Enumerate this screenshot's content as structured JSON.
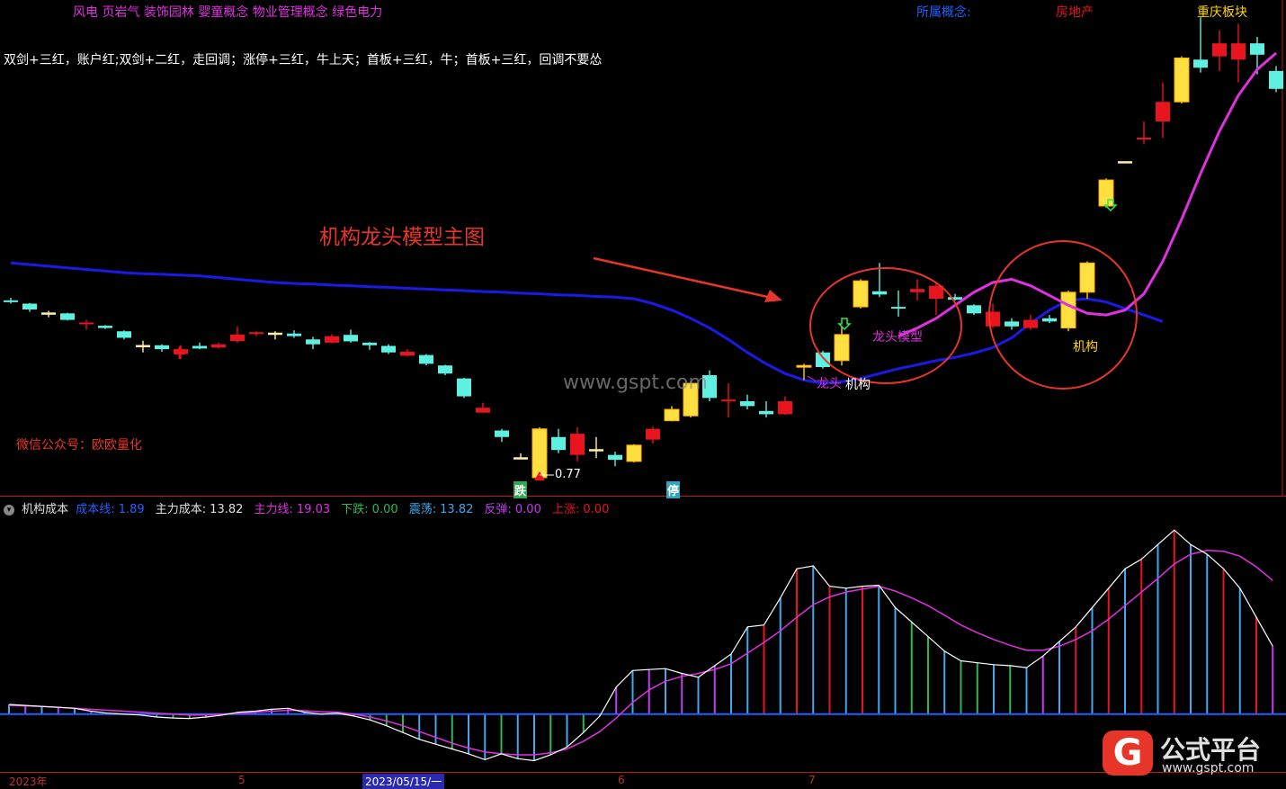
{
  "concepts": {
    "left": "风电 页岩气 装饰园林 婴童概念 物业管理概念 绿色电力",
    "belong_label": "所属概念:",
    "industry": "房地产",
    "region": "重庆板块"
  },
  "strategy_text": "双剑+三红，账户红;双剑+二红，走回调；涨停+三红，牛上天；首板+三红，牛；首板+三红，回调不要怂",
  "chart_title": "机构龙头模型主图",
  "wechat": "微信公众号：欧欧量化",
  "watermark": "www.gspt.com",
  "annotations": {
    "low_price": "0.77",
    "down_signal": "跌",
    "limit_signal": "停",
    "dragon_model": "龙头模型",
    "dragon": "龙头",
    "institution_1": "机构",
    "institution_2": "机构"
  },
  "indicator": {
    "name": "机构成本",
    "cost_line_label": "成本线:",
    "cost_line_value": "1.89",
    "main_cost_label": "主力成本:",
    "main_cost_value": "13.82",
    "main_line_label": "主力线:",
    "main_line_value": "19.03",
    "down_label": "下跌:",
    "down_value": "0.00",
    "shock_label": "震荡:",
    "shock_value": "13.82",
    "rebound_label": "反弹:",
    "rebound_value": "0.00",
    "up_label": "上涨:",
    "up_value": "0.00"
  },
  "dates": {
    "d1": "2023年",
    "d2": "5",
    "d3": "2023/05/15/一",
    "d4": "6",
    "d5": "7"
  },
  "logo": {
    "mark": "G",
    "name": "公式平台",
    "url": "www.gspt.com"
  },
  "colors": {
    "up_red": "#e8141e",
    "up_yellow": "#ffd400",
    "down_cyan": "#5ef0e0",
    "cost_line_blue": "#1a1ae6",
    "main_line_magenta": "#e030e0",
    "annotation_red": "#e8352a"
  },
  "chart_data": {
    "type": "candlestick",
    "candles": [
      {
        "o": 7.9,
        "c": 7.85,
        "h": 7.98,
        "l": 7.8,
        "t": "d"
      },
      {
        "o": 7.8,
        "c": 7.62,
        "h": 7.82,
        "l": 7.55,
        "t": "d"
      },
      {
        "o": 7.5,
        "c": 7.5,
        "h": 7.58,
        "l": 7.38,
        "t": "s"
      },
      {
        "o": 7.5,
        "c": 7.3,
        "h": 7.52,
        "l": 7.28,
        "t": "d"
      },
      {
        "o": 7.22,
        "c": 7.2,
        "h": 7.3,
        "l": 7.0,
        "t": "r"
      },
      {
        "o": 7.12,
        "c": 7.05,
        "h": 7.14,
        "l": 7.02,
        "t": "d"
      },
      {
        "o": 6.95,
        "c": 6.75,
        "h": 6.98,
        "l": 6.7,
        "t": "d"
      },
      {
        "o": 6.5,
        "c": 6.5,
        "h": 6.66,
        "l": 6.3,
        "t": "s"
      },
      {
        "o": 6.52,
        "c": 6.4,
        "h": 6.55,
        "l": 6.32,
        "t": "d"
      },
      {
        "o": 6.25,
        "c": 6.4,
        "h": 6.52,
        "l": 6.1,
        "t": "r"
      },
      {
        "o": 6.5,
        "c": 6.42,
        "h": 6.6,
        "l": 6.4,
        "t": "d"
      },
      {
        "o": 6.45,
        "c": 6.55,
        "h": 6.6,
        "l": 6.42,
        "t": "r"
      },
      {
        "o": 6.65,
        "c": 6.85,
        "h": 7.1,
        "l": 6.6,
        "t": "r"
      },
      {
        "o": 6.92,
        "c": 6.92,
        "h": 6.95,
        "l": 6.8,
        "t": "r"
      },
      {
        "o": 6.88,
        "c": 6.88,
        "h": 6.95,
        "l": 6.7,
        "t": "s"
      },
      {
        "o": 6.88,
        "c": 6.8,
        "h": 6.98,
        "l": 6.75,
        "t": "d"
      },
      {
        "o": 6.7,
        "c": 6.55,
        "h": 6.78,
        "l": 6.4,
        "t": "d"
      },
      {
        "o": 6.6,
        "c": 6.8,
        "h": 6.86,
        "l": 6.58,
        "t": "r"
      },
      {
        "o": 6.84,
        "c": 6.64,
        "h": 7.0,
        "l": 6.6,
        "t": "d"
      },
      {
        "o": 6.6,
        "c": 6.52,
        "h": 6.62,
        "l": 6.38,
        "t": "d"
      },
      {
        "o": 6.5,
        "c": 6.3,
        "h": 6.55,
        "l": 6.25,
        "t": "d"
      },
      {
        "o": 6.32,
        "c": 6.2,
        "h": 6.4,
        "l": 6.18,
        "t": "r"
      },
      {
        "o": 6.22,
        "c": 5.95,
        "h": 6.25,
        "l": 5.9,
        "t": "d"
      },
      {
        "o": 5.9,
        "c": 5.65,
        "h": 5.92,
        "l": 5.6,
        "t": "d"
      },
      {
        "o": 5.5,
        "c": 4.95,
        "h": 5.52,
        "l": 4.9,
        "t": "d"
      },
      {
        "o": 4.6,
        "c": 4.45,
        "h": 4.75,
        "l": 4.45,
        "t": "r"
      },
      {
        "o": 3.9,
        "c": 3.7,
        "h": 3.95,
        "l": 3.55,
        "t": "d"
      },
      {
        "o": 3.05,
        "c": 3.05,
        "h": 3.2,
        "l": 3.05,
        "t": "s"
      },
      {
        "o": 2.45,
        "c": 3.95,
        "h": 4.0,
        "l": 2.4,
        "t": "y"
      },
      {
        "o": 3.7,
        "c": 3.3,
        "h": 3.95,
        "l": 3.2,
        "t": "d"
      },
      {
        "o": 3.15,
        "c": 3.8,
        "h": 4.0,
        "l": 2.95,
        "t": "r"
      },
      {
        "o": 3.3,
        "c": 3.3,
        "h": 3.7,
        "l": 3.05,
        "t": "s"
      },
      {
        "o": 3.15,
        "c": 3.0,
        "h": 3.25,
        "l": 2.8,
        "t": "d"
      },
      {
        "o": 2.95,
        "c": 3.45,
        "h": 3.48,
        "l": 2.92,
        "t": "y"
      },
      {
        "o": 3.62,
        "c": 3.95,
        "h": 4.02,
        "l": 3.5,
        "t": "r"
      },
      {
        "o": 4.2,
        "c": 4.55,
        "h": 4.65,
        "l": 4.18,
        "t": "y"
      },
      {
        "o": 4.35,
        "c": 5.35,
        "h": 5.4,
        "l": 4.3,
        "t": "y"
      },
      {
        "o": 4.9,
        "c": 5.6,
        "h": 5.75,
        "l": 4.8,
        "t": "d"
      },
      {
        "o": 4.85,
        "c": 4.85,
        "h": 5.35,
        "l": 4.3,
        "t": "r"
      },
      {
        "o": 4.8,
        "c": 4.65,
        "h": 5.0,
        "l": 4.55,
        "t": "d"
      },
      {
        "o": 4.5,
        "c": 4.4,
        "h": 4.8,
        "l": 4.3,
        "t": "d"
      },
      {
        "o": 4.4,
        "c": 4.8,
        "h": 4.95,
        "l": 4.38,
        "t": "r"
      },
      {
        "o": 5.9,
        "c": 5.9,
        "h": 5.95,
        "l": 5.45,
        "t": "y"
      },
      {
        "o": 5.85,
        "c": 6.3,
        "h": 6.35,
        "l": 5.8,
        "t": "d"
      },
      {
        "o": 6.05,
        "c": 6.85,
        "h": 7.1,
        "l": 5.9,
        "t": "y"
      },
      {
        "o": 7.7,
        "c": 8.5,
        "h": 8.55,
        "l": 7.65,
        "t": "y"
      },
      {
        "o": 8.18,
        "c": 8.08,
        "h": 9.05,
        "l": 8.0,
        "t": "d"
      },
      {
        "o": 7.7,
        "c": 7.7,
        "h": 8.2,
        "l": 7.4,
        "t": "d"
      },
      {
        "o": 8.15,
        "c": 8.25,
        "h": 8.55,
        "l": 7.9,
        "t": "r"
      },
      {
        "o": 7.95,
        "c": 8.35,
        "h": 8.45,
        "l": 7.45,
        "t": "r"
      },
      {
        "o": 8.0,
        "c": 7.92,
        "h": 8.1,
        "l": 7.9,
        "t": "d"
      },
      {
        "o": 7.75,
        "c": 7.5,
        "h": 7.78,
        "l": 7.45,
        "t": "d"
      },
      {
        "o": 7.55,
        "c": 7.1,
        "h": 7.8,
        "l": 7.05,
        "t": "r"
      },
      {
        "o": 7.25,
        "c": 7.1,
        "h": 7.35,
        "l": 7.0,
        "t": "d"
      },
      {
        "o": 7.05,
        "c": 7.3,
        "h": 7.45,
        "l": 7.0,
        "t": "r"
      },
      {
        "o": 7.35,
        "c": 7.25,
        "h": 7.45,
        "l": 7.2,
        "t": "d"
      },
      {
        "o": 7.05,
        "c": 8.15,
        "h": 8.2,
        "l": 6.95,
        "t": "y"
      },
      {
        "o": 8.15,
        "c": 9.05,
        "h": 9.1,
        "l": 7.95,
        "t": "y"
      },
      {
        "o": 10.8,
        "c": 11.6,
        "h": 11.65,
        "l": 10.75,
        "t": "y"
      },
      {
        "o": 12.15,
        "c": 12.15,
        "h": 12.15,
        "l": 12.12,
        "t": "s"
      },
      {
        "o": 12.9,
        "c": 12.9,
        "h": 13.4,
        "l": 12.7,
        "t": "r"
      },
      {
        "o": 13.4,
        "c": 14.0,
        "h": 14.6,
        "l": 12.9,
        "t": "r"
      },
      {
        "o": 14.0,
        "c": 15.35,
        "h": 15.4,
        "l": 13.95,
        "t": "y"
      },
      {
        "o": 15.05,
        "c": 15.3,
        "h": 16.6,
        "l": 14.9,
        "t": "d"
      },
      {
        "o": 15.4,
        "c": 15.8,
        "h": 16.2,
        "l": 14.95,
        "t": "r"
      },
      {
        "o": 15.3,
        "c": 15.8,
        "h": 16.4,
        "l": 14.6,
        "t": "r"
      },
      {
        "o": 15.8,
        "c": 15.45,
        "h": 16.0,
        "l": 14.85,
        "t": "d"
      },
      {
        "o": 14.95,
        "c": 14.4,
        "h": 15.1,
        "l": 14.3,
        "t": "d"
      }
    ],
    "cost_line": [
      9.05,
      9.0,
      8.95,
      8.9,
      8.85,
      8.8,
      8.75,
      8.72,
      8.7,
      8.68,
      8.65,
      8.6,
      8.55,
      8.5,
      8.45,
      8.42,
      8.4,
      8.37,
      8.35,
      8.32,
      8.3,
      8.27,
      8.25,
      8.22,
      8.2,
      8.17,
      8.15,
      8.12,
      8.1,
      8.07,
      8.05,
      8.02,
      8.0,
      7.95,
      7.8,
      7.6,
      7.35,
      7.05,
      6.7,
      6.3,
      5.95,
      5.65,
      5.45,
      5.35,
      5.4,
      5.5,
      5.65,
      5.8,
      5.92,
      6.05,
      6.15,
      6.28,
      6.45,
      6.75,
      7.2,
      7.6,
      7.9,
      7.95,
      7.85,
      7.65,
      7.45,
      7.25
    ],
    "main_line": [
      6.8,
      7.05,
      7.35,
      7.75,
      8.15,
      8.45,
      8.55,
      8.35,
      8.05,
      7.75,
      7.5,
      7.45,
      7.6,
      8.1,
      9.1,
      10.4,
      11.8,
      13.1,
      14.2,
      15.0,
      15.5
    ],
    "main_line_start": 47,
    "price_range": [
      2.2,
      16.8
    ],
    "osc_white": [
      1.0,
      0.9,
      0.8,
      0.7,
      0.6,
      0.3,
      0.1,
      0.0,
      -0.1,
      -0.3,
      -0.4,
      -0.45,
      -0.3,
      -0.1,
      0.2,
      0.3,
      0.5,
      0.6,
      0.2,
      0.0,
      0.1,
      -0.2,
      -0.6,
      -1.2,
      -1.9,
      -2.6,
      -3.1,
      -3.6,
      -4.1,
      -4.7,
      -4.1,
      -4.6,
      -4.8,
      -4.2,
      -3.4,
      -1.9,
      -0.2,
      2.8,
      4.5,
      4.6,
      4.7,
      4.2,
      3.8,
      5.0,
      6.2,
      9.0,
      9.2,
      12.0,
      15.0,
      15.3,
      13.2,
      13.0,
      13.2,
      13.3,
      11.0,
      9.5,
      8.0,
      6.5,
      5.5,
      5.3,
      5.1,
      5.0,
      4.8,
      6.0,
      7.5,
      9.0,
      11.0,
      13.0,
      15.0,
      16.0,
      17.5,
      19.0,
      17.5,
      16.5,
      15.0,
      13.0,
      10.0,
      7.0
    ],
    "osc_magenta": [
      0.9,
      0.85,
      0.8,
      0.7,
      0.6,
      0.5,
      0.4,
      0.3,
      0.2,
      0.1,
      0.0,
      -0.1,
      -0.1,
      0.0,
      0.1,
      0.2,
      0.3,
      0.4,
      0.35,
      0.25,
      0.2,
      0.0,
      -0.3,
      -0.7,
      -1.2,
      -1.8,
      -2.4,
      -3.0,
      -3.5,
      -3.9,
      -4.1,
      -4.2,
      -4.2,
      -4.0,
      -3.6,
      -2.8,
      -1.8,
      -0.4,
      1.2,
      2.5,
      3.4,
      3.9,
      4.2,
      4.6,
      5.2,
      6.3,
      7.4,
      8.6,
      10.0,
      11.3,
      12.1,
      12.6,
      12.9,
      13.2,
      12.7,
      12.0,
      11.2,
      10.2,
      9.2,
      8.4,
      7.7,
      7.1,
      6.6,
      6.6,
      7.0,
      7.7,
      8.6,
      9.8,
      11.2,
      12.6,
      14.0,
      15.5,
      16.5,
      16.9,
      16.8,
      16.3,
      15.2,
      13.8
    ],
    "osc_range": [
      -5.5,
      20.5
    ]
  }
}
